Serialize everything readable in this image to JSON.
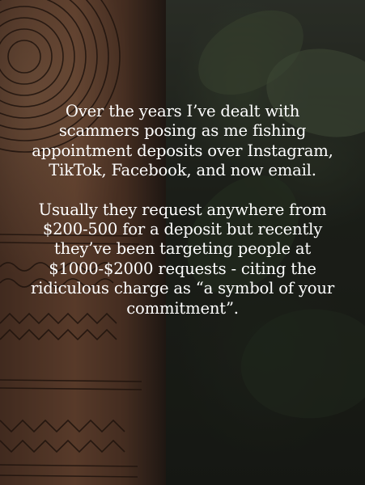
{
  "post": {
    "paragraphs": [
      "Over the years I’ve dealt with scammers posing as me fishing appointment deposits over Instagram, TikTok, Facebook, and now email.",
      "Usually they request anywhere from $200-500 for a deposit but recently they’ve been targeting people at $1000-$2000 requests - citing the ridiculous charge as “a symbol of your commitment”."
    ]
  }
}
